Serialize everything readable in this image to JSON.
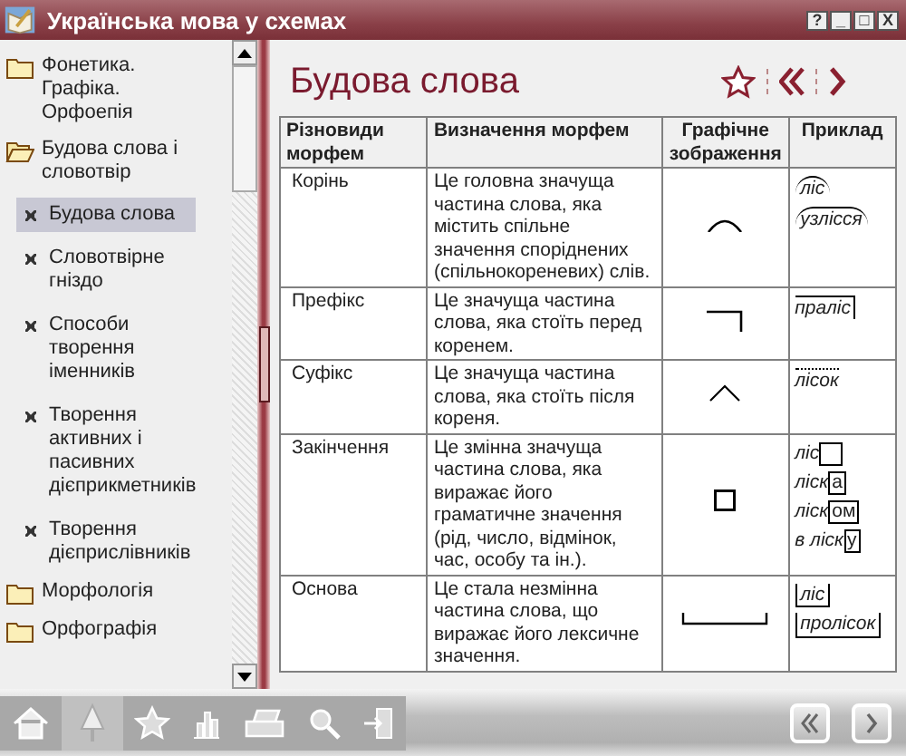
{
  "window": {
    "title": "Українська мова у схемах",
    "buttons": [
      "?",
      "_",
      "□",
      "X"
    ]
  },
  "sidebar": {
    "items": [
      {
        "label": "Фонетика. Графіка. Орфоепія",
        "expanded": false
      },
      {
        "label": "Будова слова і словотвір",
        "expanded": true,
        "children": [
          {
            "label": "Будова слова",
            "selected": true
          },
          {
            "label": "Словотвірне гніздо",
            "selected": false
          },
          {
            "label": "Способи творення іменників",
            "selected": false
          },
          {
            "label": "Творення активних і пасивних дієприкметників",
            "selected": false
          },
          {
            "label": "Творення дієприслівників",
            "selected": false
          }
        ]
      },
      {
        "label": "Морфологія",
        "expanded": false
      },
      {
        "label": "Орфографія",
        "expanded": false
      }
    ]
  },
  "page": {
    "title": "Будова слова",
    "table": {
      "columns": [
        "Різновиди морфем",
        "Визначення морфем",
        "Графічне зображення",
        "Приклад"
      ],
      "rows": [
        {
          "kind": "root",
          "name": "Корінь",
          "definition": "Це головна значуща частина слова, яка містить спільне значення споріднених (спільнокореневих) слів.",
          "examples": [
            {
              "text": "ліс"
            },
            {
              "text": "узлісся"
            }
          ]
        },
        {
          "kind": "prefix",
          "name": "Префікс",
          "definition": "Це значуща частина слова, яка стоїть перед коренем.",
          "examples": [
            {
              "text": "праліс"
            }
          ]
        },
        {
          "kind": "suffix",
          "name": "Суфікс",
          "definition": "Це значуща частина слова, яка стоїть після кореня.",
          "examples": [
            {
              "text": "лісок"
            }
          ]
        },
        {
          "kind": "ending",
          "name": "Закінчення",
          "definition": "Це змінна значуща частина слова, яка виражає його граматичне значення (рід, число, відмінок, час, особу та ін.).",
          "examples": [
            {
              "text": "ліс"
            },
            {
              "text": "ліск",
              "ending": "а"
            },
            {
              "text": "ліск",
              "ending": "ом"
            },
            {
              "text": "в ліск",
              "ending": "у"
            }
          ]
        },
        {
          "kind": "base",
          "name": "Основа",
          "definition": "Це стала незмінна частина слова, що виражає його лексичне значення.",
          "examples": [
            {
              "text": "ліс"
            },
            {
              "text": "пролісок"
            }
          ]
        }
      ]
    }
  }
}
